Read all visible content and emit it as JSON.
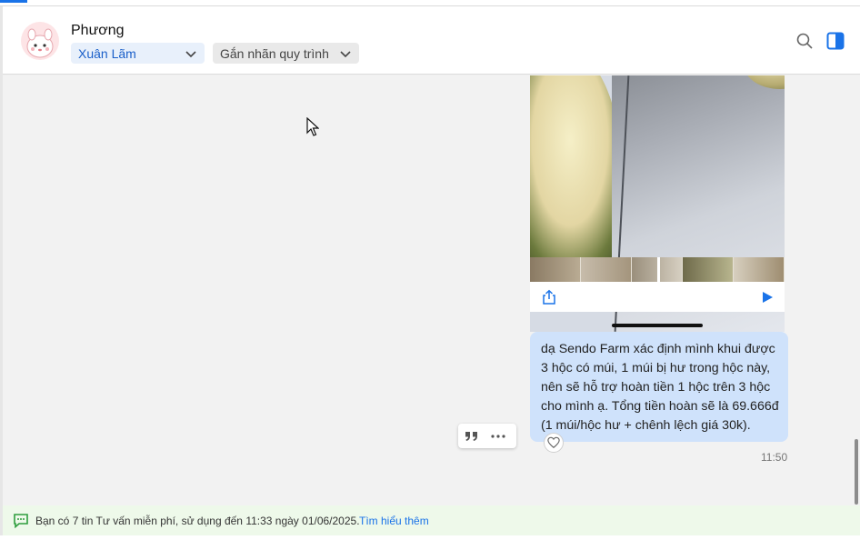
{
  "header": {
    "contact_name": "Phương",
    "assignee_label": "Xuân Lãm",
    "workflow_label": "Gắn nhãn quy trình"
  },
  "icons": {
    "search": "search-icon",
    "panel": "side-panel-icon",
    "share": "share-icon",
    "play": "play-icon",
    "quote": "quote-icon",
    "more": "more-icon",
    "heart": "heart-icon",
    "chat": "chat-bubble-icon"
  },
  "message": {
    "lines": [
      "dạ Sendo Farm xác định mình khui được",
      "3 hộc có múi, 1 múi bị hư trong hộc này,",
      "nên sẽ hỗ trợ hoàn tiền 1 hộc trên 3 hộc",
      "cho mình ạ. Tổng tiền hoàn sẽ là 69.666đ",
      "(1 múi/hộc hư + chênh lệch giá 30k)."
    ],
    "time": "11:50"
  },
  "banner": {
    "text": "Bạn có 7 tin Tư vấn miễn phí, sử dụng đến 11:33 ngày 01/06/2025.",
    "link": "Tìm hiểu thêm"
  },
  "colors": {
    "accent": "#1a73e8",
    "bubble": "#cfe2fb",
    "banner_bg": "#eef9ea",
    "banner_icon": "#2e9e3d"
  }
}
